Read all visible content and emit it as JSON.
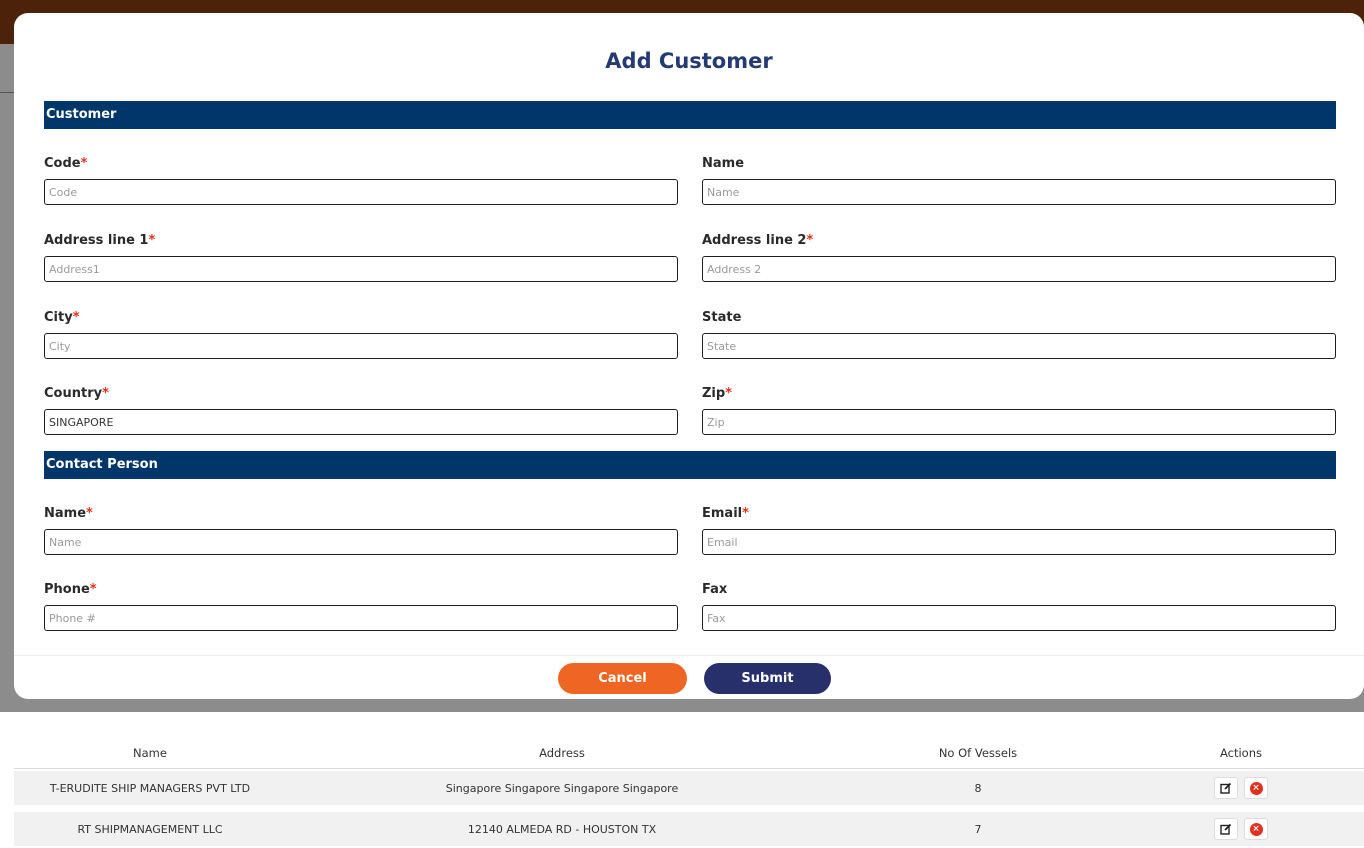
{
  "modal": {
    "title": "Add Customer",
    "sections": {
      "customer": "Customer",
      "contact": "Contact Person"
    },
    "customer_fields": {
      "code": {
        "label": "Code",
        "required": "*",
        "placeholder": "Code",
        "value": ""
      },
      "name": {
        "label": "Name",
        "placeholder": "Name",
        "value": ""
      },
      "address1": {
        "label": "Address line 1",
        "required": "*",
        "placeholder": "Address1",
        "value": ""
      },
      "address2": {
        "label": "Address line 2",
        "required": "*",
        "placeholder": "Address 2",
        "value": ""
      },
      "city": {
        "label": "City",
        "required": "*",
        "placeholder": "City",
        "value": ""
      },
      "state": {
        "label": "State",
        "placeholder": "State",
        "value": ""
      },
      "country": {
        "label": "Country",
        "required": "*",
        "placeholder": "",
        "value": "SINGAPORE"
      },
      "zip": {
        "label": "Zip",
        "required": "*",
        "placeholder": "Zip",
        "value": ""
      }
    },
    "contact_fields": {
      "name": {
        "label": "Name",
        "required": "*",
        "placeholder": "Name",
        "value": ""
      },
      "email": {
        "label": "Email",
        "required": "*",
        "placeholder": "Email",
        "value": ""
      },
      "phone": {
        "label": "Phone",
        "required": "*",
        "placeholder": "Phone #",
        "value": ""
      },
      "fax": {
        "label": "Fax",
        "placeholder": "Fax",
        "value": ""
      }
    },
    "buttons": {
      "cancel": "Cancel",
      "submit": "Submit"
    }
  },
  "table": {
    "headers": {
      "name": "Name",
      "address": "Address",
      "vessels": "No Of Vessels",
      "actions": "Actions"
    },
    "rows": [
      {
        "name": "T-ERUDITE SHIP MANAGERS PVT LTD",
        "address": "Singapore Singapore Singapore Singapore",
        "vessels": "8"
      },
      {
        "name": "RT SHIPMANAGEMENT LLC",
        "address": "12140 ALMEDA RD - HOUSTON TX",
        "vessels": "7"
      }
    ]
  },
  "colors": {
    "title": "#243a73",
    "section_bar": "#00366a",
    "required": "#e0301e",
    "cancel": "#ef6524",
    "submit": "#27306b",
    "delete_icon": "#e0301e"
  },
  "icons": {
    "edit": "edit-icon",
    "delete": "delete-icon"
  }
}
